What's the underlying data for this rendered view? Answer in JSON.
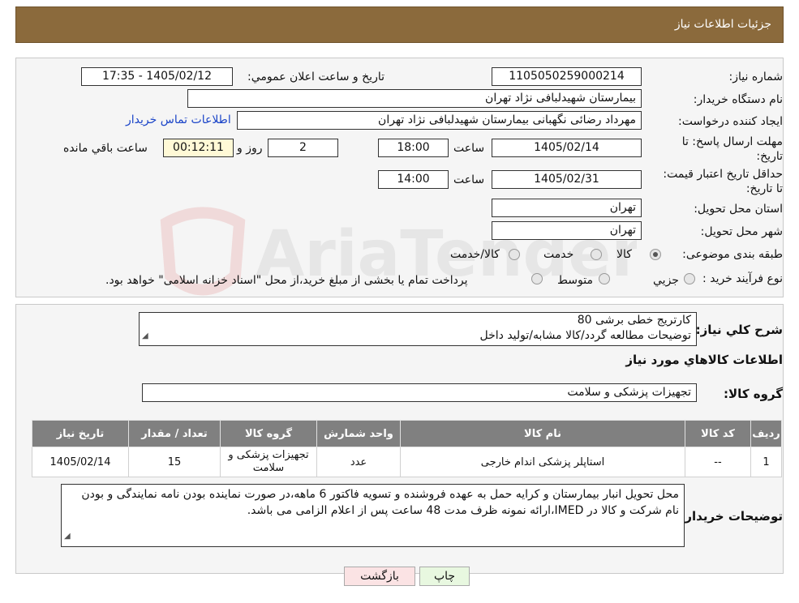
{
  "header": {
    "title": "جزئیات اطلاعات نیاز"
  },
  "watermark": {
    "text": "AriaTender.neT"
  },
  "form": {
    "need_number_label": "شماره نیاز:",
    "need_number": "1105050259000214",
    "announce_label": "تاريخ و ساعت اعلان عمومي:",
    "announce_value": "1405/02/12 - 17:35",
    "buyer_org_label": "نام دستگاه خريدار:",
    "buyer_org": "بيمارستان شهيدلبافی نژاد تهران",
    "creator_label": "ايجاد کننده درخواست:",
    "creator": "مهرداد رضائی نگهبانی بيمارستان شهيدلبافی نژاد تهران",
    "contact_link": "اطلاعات تماس خريدار",
    "deadline_label": "مهلت ارسال پاسخ: تا تاريخ:",
    "deadline_date": "1405/02/14",
    "time_label": "ساعت",
    "deadline_time": "18:00",
    "days": "2",
    "days_label": "روز و",
    "remaining": "00:12:11",
    "remaining_label": "ساعت باقي مانده",
    "validity_label": "حداقل تاريخ اعتبار قيمت: تا تاريخ:",
    "validity_date": "1405/02/31",
    "validity_time": "14:00",
    "province_label": "استان محل تحويل:",
    "province": "تهران",
    "city_label": "شهر محل تحويل:",
    "city": "تهران",
    "category_label": "طبقه بندی موضوعی:",
    "category_options": [
      "کالا",
      "خدمت",
      "کالا/خدمت"
    ],
    "process_label": "نوع فرآيند خريد :",
    "process_options": [
      "جزيي",
      "متوسط"
    ],
    "process_note": "پرداخت تمام يا بخشی از مبلغ خريد،از محل \"اسناد خزانه اسلامی\" خواهد بود."
  },
  "summary": {
    "label": "شرح کلي نياز:",
    "line1": "کارتريج خطی برشی 80",
    "line2": "توضيحات مطالعه گردد/کالا مشابه/توليد داخل"
  },
  "goods": {
    "section_title": "اطلاعات کالاهاي مورد نياز",
    "group_label": "گروه کالا:",
    "group": "تجهيزات پزشکی و سلامت",
    "columns": [
      "رديف",
      "کد کالا",
      "نام کالا",
      "واحد شمارش",
      "گروه کالا",
      "تعداد / مقدار",
      "تاريخ نياز"
    ],
    "rows": [
      {
        "row": "1",
        "code": "--",
        "name": "استاپلر پزشکی اندام خارجی",
        "unit": "عدد",
        "group": "تجهيزات پزشکی و سلامت",
        "qty": "15",
        "date": "1405/02/14"
      }
    ]
  },
  "buyer_notes": {
    "label": "توضيحات خريدار:",
    "text": "محل تحويل انبار بيمارستان و کرايه حمل به عهده فروشنده و تسويه فاکتور 6 ماهه،در صورت نماينده بودن نامه نمايندگی و بودن نام شرکت و کالا در IMED،ارائه نمونه ظرف مدت 48 ساعت پس از اعلام الزامی می باشد."
  },
  "buttons": {
    "print": "چاپ",
    "back": "بازگشت"
  },
  "colors": {
    "header_bg": "#8b6a3c",
    "table_header_bg": "#808080",
    "back_bg": "#fbe3e4",
    "print_bg": "#e8f8e0",
    "link": "#1a44c8"
  }
}
